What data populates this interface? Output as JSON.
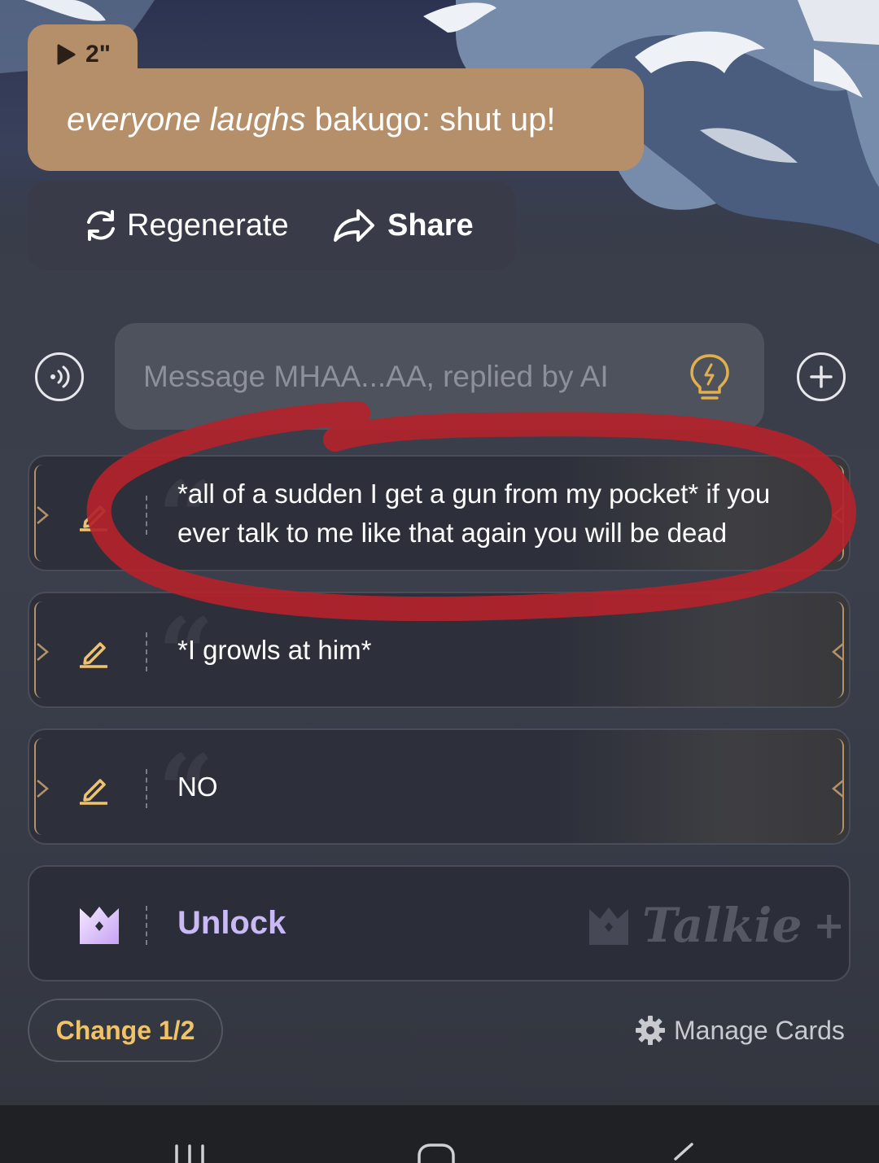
{
  "colors": {
    "bubble": "#b58f6a",
    "accent_gold": "#f0c36a",
    "annotation_red": "#b3232b",
    "unlock_purple": "#c9b9f5"
  },
  "audio_chip": {
    "icon": "play-icon",
    "duration": "2\""
  },
  "ai_message": {
    "italic_action": "everyone laughs",
    "text": " bakugo: shut up!"
  },
  "actions": {
    "regenerate": {
      "icon": "refresh-icon",
      "label": "Regenerate"
    },
    "share": {
      "icon": "share-arrow-icon",
      "label": "Share"
    }
  },
  "composer": {
    "voice_icon": "voice-icon",
    "placeholder": "Message MHAA...AA, replied by AI",
    "hint_icon": "lightbulb-icon",
    "add_icon": "plus-icon"
  },
  "reply_cards": [
    {
      "text": "*all of a sudden I get a gun from my pocket* if you ever talk to me like that again you will be dead"
    },
    {
      "text": "*I growls at him*"
    },
    {
      "text": "NO"
    }
  ],
  "unlock": {
    "icon": "crown-icon",
    "label": "Unlock",
    "brand": "Talkie",
    "brand_plus": "+"
  },
  "footer": {
    "change": "Change 1/2",
    "manage_icon": "gear-icon",
    "manage": "Manage Cards"
  },
  "system_nav": {
    "icons": [
      "recent-apps-icon",
      "home-icon",
      "back-icon"
    ]
  }
}
